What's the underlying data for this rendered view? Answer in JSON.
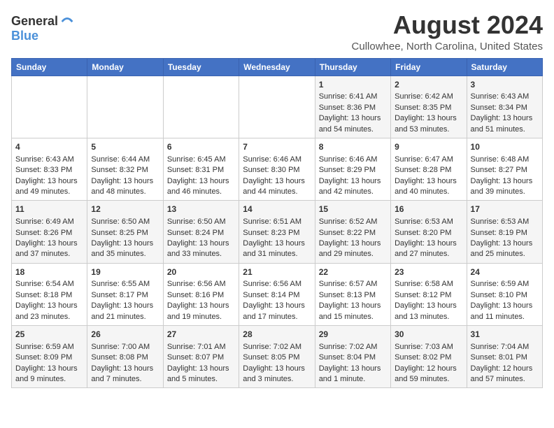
{
  "logo": {
    "line1": "General",
    "line2": "Blue"
  },
  "title": "August 2024",
  "subtitle": "Cullowhee, North Carolina, United States",
  "headers": [
    "Sunday",
    "Monday",
    "Tuesday",
    "Wednesday",
    "Thursday",
    "Friday",
    "Saturday"
  ],
  "weeks": [
    [
      {
        "day": "",
        "lines": []
      },
      {
        "day": "",
        "lines": []
      },
      {
        "day": "",
        "lines": []
      },
      {
        "day": "",
        "lines": []
      },
      {
        "day": "1",
        "lines": [
          "Sunrise: 6:41 AM",
          "Sunset: 8:36 PM",
          "Daylight: 13 hours",
          "and 54 minutes."
        ]
      },
      {
        "day": "2",
        "lines": [
          "Sunrise: 6:42 AM",
          "Sunset: 8:35 PM",
          "Daylight: 13 hours",
          "and 53 minutes."
        ]
      },
      {
        "day": "3",
        "lines": [
          "Sunrise: 6:43 AM",
          "Sunset: 8:34 PM",
          "Daylight: 13 hours",
          "and 51 minutes."
        ]
      }
    ],
    [
      {
        "day": "4",
        "lines": [
          "Sunrise: 6:43 AM",
          "Sunset: 8:33 PM",
          "Daylight: 13 hours",
          "and 49 minutes."
        ]
      },
      {
        "day": "5",
        "lines": [
          "Sunrise: 6:44 AM",
          "Sunset: 8:32 PM",
          "Daylight: 13 hours",
          "and 48 minutes."
        ]
      },
      {
        "day": "6",
        "lines": [
          "Sunrise: 6:45 AM",
          "Sunset: 8:31 PM",
          "Daylight: 13 hours",
          "and 46 minutes."
        ]
      },
      {
        "day": "7",
        "lines": [
          "Sunrise: 6:46 AM",
          "Sunset: 8:30 PM",
          "Daylight: 13 hours",
          "and 44 minutes."
        ]
      },
      {
        "day": "8",
        "lines": [
          "Sunrise: 6:46 AM",
          "Sunset: 8:29 PM",
          "Daylight: 13 hours",
          "and 42 minutes."
        ]
      },
      {
        "day": "9",
        "lines": [
          "Sunrise: 6:47 AM",
          "Sunset: 8:28 PM",
          "Daylight: 13 hours",
          "and 40 minutes."
        ]
      },
      {
        "day": "10",
        "lines": [
          "Sunrise: 6:48 AM",
          "Sunset: 8:27 PM",
          "Daylight: 13 hours",
          "and 39 minutes."
        ]
      }
    ],
    [
      {
        "day": "11",
        "lines": [
          "Sunrise: 6:49 AM",
          "Sunset: 8:26 PM",
          "Daylight: 13 hours",
          "and 37 minutes."
        ]
      },
      {
        "day": "12",
        "lines": [
          "Sunrise: 6:50 AM",
          "Sunset: 8:25 PM",
          "Daylight: 13 hours",
          "and 35 minutes."
        ]
      },
      {
        "day": "13",
        "lines": [
          "Sunrise: 6:50 AM",
          "Sunset: 8:24 PM",
          "Daylight: 13 hours",
          "and 33 minutes."
        ]
      },
      {
        "day": "14",
        "lines": [
          "Sunrise: 6:51 AM",
          "Sunset: 8:23 PM",
          "Daylight: 13 hours",
          "and 31 minutes."
        ]
      },
      {
        "day": "15",
        "lines": [
          "Sunrise: 6:52 AM",
          "Sunset: 8:22 PM",
          "Daylight: 13 hours",
          "and 29 minutes."
        ]
      },
      {
        "day": "16",
        "lines": [
          "Sunrise: 6:53 AM",
          "Sunset: 8:20 PM",
          "Daylight: 13 hours",
          "and 27 minutes."
        ]
      },
      {
        "day": "17",
        "lines": [
          "Sunrise: 6:53 AM",
          "Sunset: 8:19 PM",
          "Daylight: 13 hours",
          "and 25 minutes."
        ]
      }
    ],
    [
      {
        "day": "18",
        "lines": [
          "Sunrise: 6:54 AM",
          "Sunset: 8:18 PM",
          "Daylight: 13 hours",
          "and 23 minutes."
        ]
      },
      {
        "day": "19",
        "lines": [
          "Sunrise: 6:55 AM",
          "Sunset: 8:17 PM",
          "Daylight: 13 hours",
          "and 21 minutes."
        ]
      },
      {
        "day": "20",
        "lines": [
          "Sunrise: 6:56 AM",
          "Sunset: 8:16 PM",
          "Daylight: 13 hours",
          "and 19 minutes."
        ]
      },
      {
        "day": "21",
        "lines": [
          "Sunrise: 6:56 AM",
          "Sunset: 8:14 PM",
          "Daylight: 13 hours",
          "and 17 minutes."
        ]
      },
      {
        "day": "22",
        "lines": [
          "Sunrise: 6:57 AM",
          "Sunset: 8:13 PM",
          "Daylight: 13 hours",
          "and 15 minutes."
        ]
      },
      {
        "day": "23",
        "lines": [
          "Sunrise: 6:58 AM",
          "Sunset: 8:12 PM",
          "Daylight: 13 hours",
          "and 13 minutes."
        ]
      },
      {
        "day": "24",
        "lines": [
          "Sunrise: 6:59 AM",
          "Sunset: 8:10 PM",
          "Daylight: 13 hours",
          "and 11 minutes."
        ]
      }
    ],
    [
      {
        "day": "25",
        "lines": [
          "Sunrise: 6:59 AM",
          "Sunset: 8:09 PM",
          "Daylight: 13 hours",
          "and 9 minutes."
        ]
      },
      {
        "day": "26",
        "lines": [
          "Sunrise: 7:00 AM",
          "Sunset: 8:08 PM",
          "Daylight: 13 hours",
          "and 7 minutes."
        ]
      },
      {
        "day": "27",
        "lines": [
          "Sunrise: 7:01 AM",
          "Sunset: 8:07 PM",
          "Daylight: 13 hours",
          "and 5 minutes."
        ]
      },
      {
        "day": "28",
        "lines": [
          "Sunrise: 7:02 AM",
          "Sunset: 8:05 PM",
          "Daylight: 13 hours",
          "and 3 minutes."
        ]
      },
      {
        "day": "29",
        "lines": [
          "Sunrise: 7:02 AM",
          "Sunset: 8:04 PM",
          "Daylight: 13 hours",
          "and 1 minute."
        ]
      },
      {
        "day": "30",
        "lines": [
          "Sunrise: 7:03 AM",
          "Sunset: 8:02 PM",
          "Daylight: 12 hours",
          "and 59 minutes."
        ]
      },
      {
        "day": "31",
        "lines": [
          "Sunrise: 7:04 AM",
          "Sunset: 8:01 PM",
          "Daylight: 12 hours",
          "and 57 minutes."
        ]
      }
    ]
  ]
}
